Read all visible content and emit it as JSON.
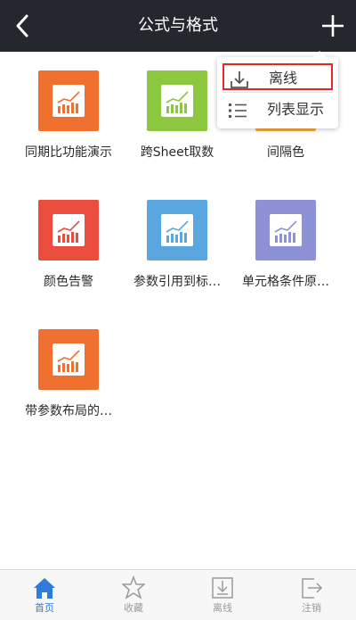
{
  "header": {
    "title": "公式与格式"
  },
  "dropdown": {
    "items": [
      {
        "label": "离线",
        "icon": "download-icon"
      },
      {
        "label": "列表显示",
        "icon": "list-icon"
      }
    ]
  },
  "tiles": [
    {
      "label": "同期比功能演示",
      "color": "#f07030"
    },
    {
      "label": "跨Sheet取数",
      "color": "#8dc63f"
    },
    {
      "label": "间隔色",
      "color": "#f3a93c"
    },
    {
      "label": "颜色告警",
      "color": "#ea4c3e"
    },
    {
      "label": "参数引用到标…",
      "color": "#5aa7e0"
    },
    {
      "label": "单元格条件原…",
      "color": "#8d91d6"
    },
    {
      "label": "带参数布局的…",
      "color": "#f07030"
    }
  ],
  "tabbar": {
    "tabs": [
      {
        "label": "首页",
        "icon": "home-icon",
        "active": true
      },
      {
        "label": "收藏",
        "icon": "star-icon",
        "active": false
      },
      {
        "label": "离线",
        "icon": "download-icon",
        "active": false
      },
      {
        "label": "注销",
        "icon": "logout-icon",
        "active": false
      }
    ]
  },
  "colors": {
    "header_bg": "#24272e",
    "active_tab": "#2f7bd9",
    "highlight": "#e02a2a"
  }
}
